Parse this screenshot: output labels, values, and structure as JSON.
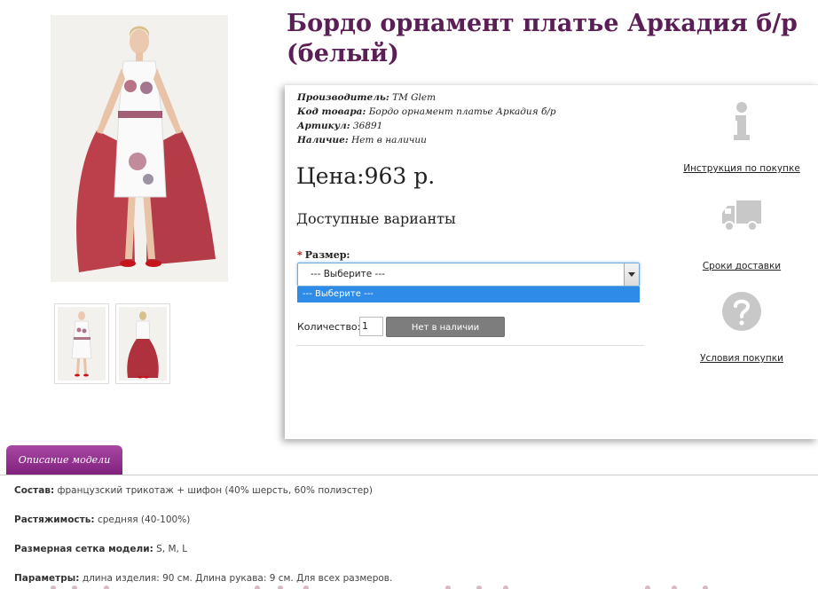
{
  "product": {
    "title": "Бордо орнамент платье Аркадия б/р (белый)",
    "manufacturer_label": "Производитель:",
    "manufacturer_value": "ТМ Glem",
    "code_label": "Код товара:",
    "code_value": "Бордо орнамент платье Аркадия б/р",
    "article_label": "Артикул:",
    "article_value": "36891",
    "availability_label": "Наличие:",
    "availability_value": "Нет в наличии",
    "price": "Цена:963 р."
  },
  "options": {
    "heading": "Доступные варианты",
    "required_mark": "*",
    "size_label": "Размер:",
    "size_selected": "--- Выберите ---",
    "size_option_highlighted": "--- Выберите ---"
  },
  "purchase": {
    "quantity_label": "Количество:",
    "quantity_value": "1",
    "button_label": "Нет в наличии"
  },
  "side_links": {
    "instruction": "Инструкция по покупке",
    "delivery": "Сроки доставки",
    "terms": "Условия покупки"
  },
  "tabs": {
    "description": "Описание модели"
  },
  "description": {
    "composition_label": "Состав:",
    "composition_value": "французский трикотаж + шифон (40% шерсть, 60% полиэстер)",
    "stretch_label": "Растяжимость:",
    "stretch_value": "средняя (40-100%)",
    "sizes_label": "Размерная сетка модели:",
    "sizes_value": "S, M, L",
    "params_label": "Параметры:",
    "params_value": "длина изделия: 90 см. Длина рукава: 9 см. Для всех размеров."
  },
  "colors": {
    "title": "#5b1e57",
    "tab": "#8e2c8b",
    "dress_red": "#a8202c",
    "select_highlight": "#2f8be8"
  }
}
